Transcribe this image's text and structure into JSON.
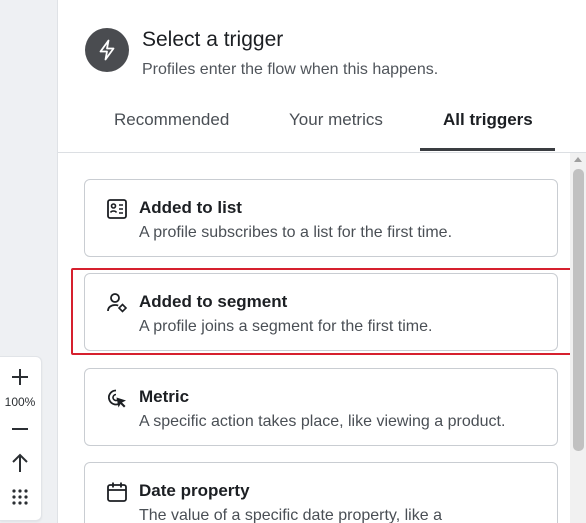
{
  "zoom": {
    "plus_icon": "plus-icon",
    "level": "100%",
    "minus_icon": "minus-icon",
    "fit_icon": "arrow-up-icon",
    "grid_icon": "grid-dots-icon"
  },
  "header": {
    "icon": "lightning-icon",
    "title": "Select a trigger",
    "subtitle": "Profiles enter the flow when this happens."
  },
  "tabs": [
    {
      "label": "Recommended",
      "active": false
    },
    {
      "label": "Your metrics",
      "active": false
    },
    {
      "label": "All triggers",
      "active": true
    }
  ],
  "triggers": [
    {
      "icon": "list-icon",
      "title": "Added to list",
      "description": "A profile subscribes to a list for the first time.",
      "highlighted": false
    },
    {
      "icon": "user-segment-icon",
      "title": "Added to segment",
      "description": "A profile joins a segment for the first time.",
      "highlighted": true
    },
    {
      "icon": "cursor-click-icon",
      "title": "Metric",
      "description": "A specific action takes place, like viewing a product.",
      "highlighted": false
    },
    {
      "icon": "calendar-icon",
      "title": "Date property",
      "description": "The value of a specific date property, like a",
      "highlighted": false
    }
  ],
  "colors": {
    "highlight": "#d6202e",
    "icon_bg": "#4a4c50"
  }
}
